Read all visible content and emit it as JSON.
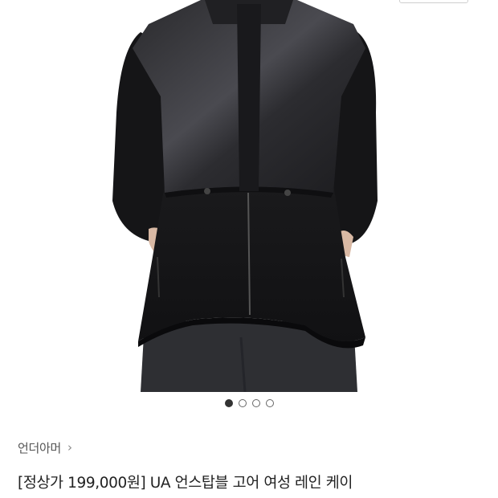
{
  "product": {
    "brand": "언더아머",
    "brand_chevron": "›",
    "title": "[정상가 199,000원] UA 언스탑블 고어 여성 레인 케이",
    "image_subject": "black-rain-jacket",
    "carousel": {
      "total": 4,
      "active_index": 0
    }
  },
  "colors": {
    "jacket": "#1b1b1d",
    "jacket_shine": "#3a3a3e",
    "pants": "#2e2f33",
    "dot_active": "#333333",
    "dot_border": "#666666"
  }
}
